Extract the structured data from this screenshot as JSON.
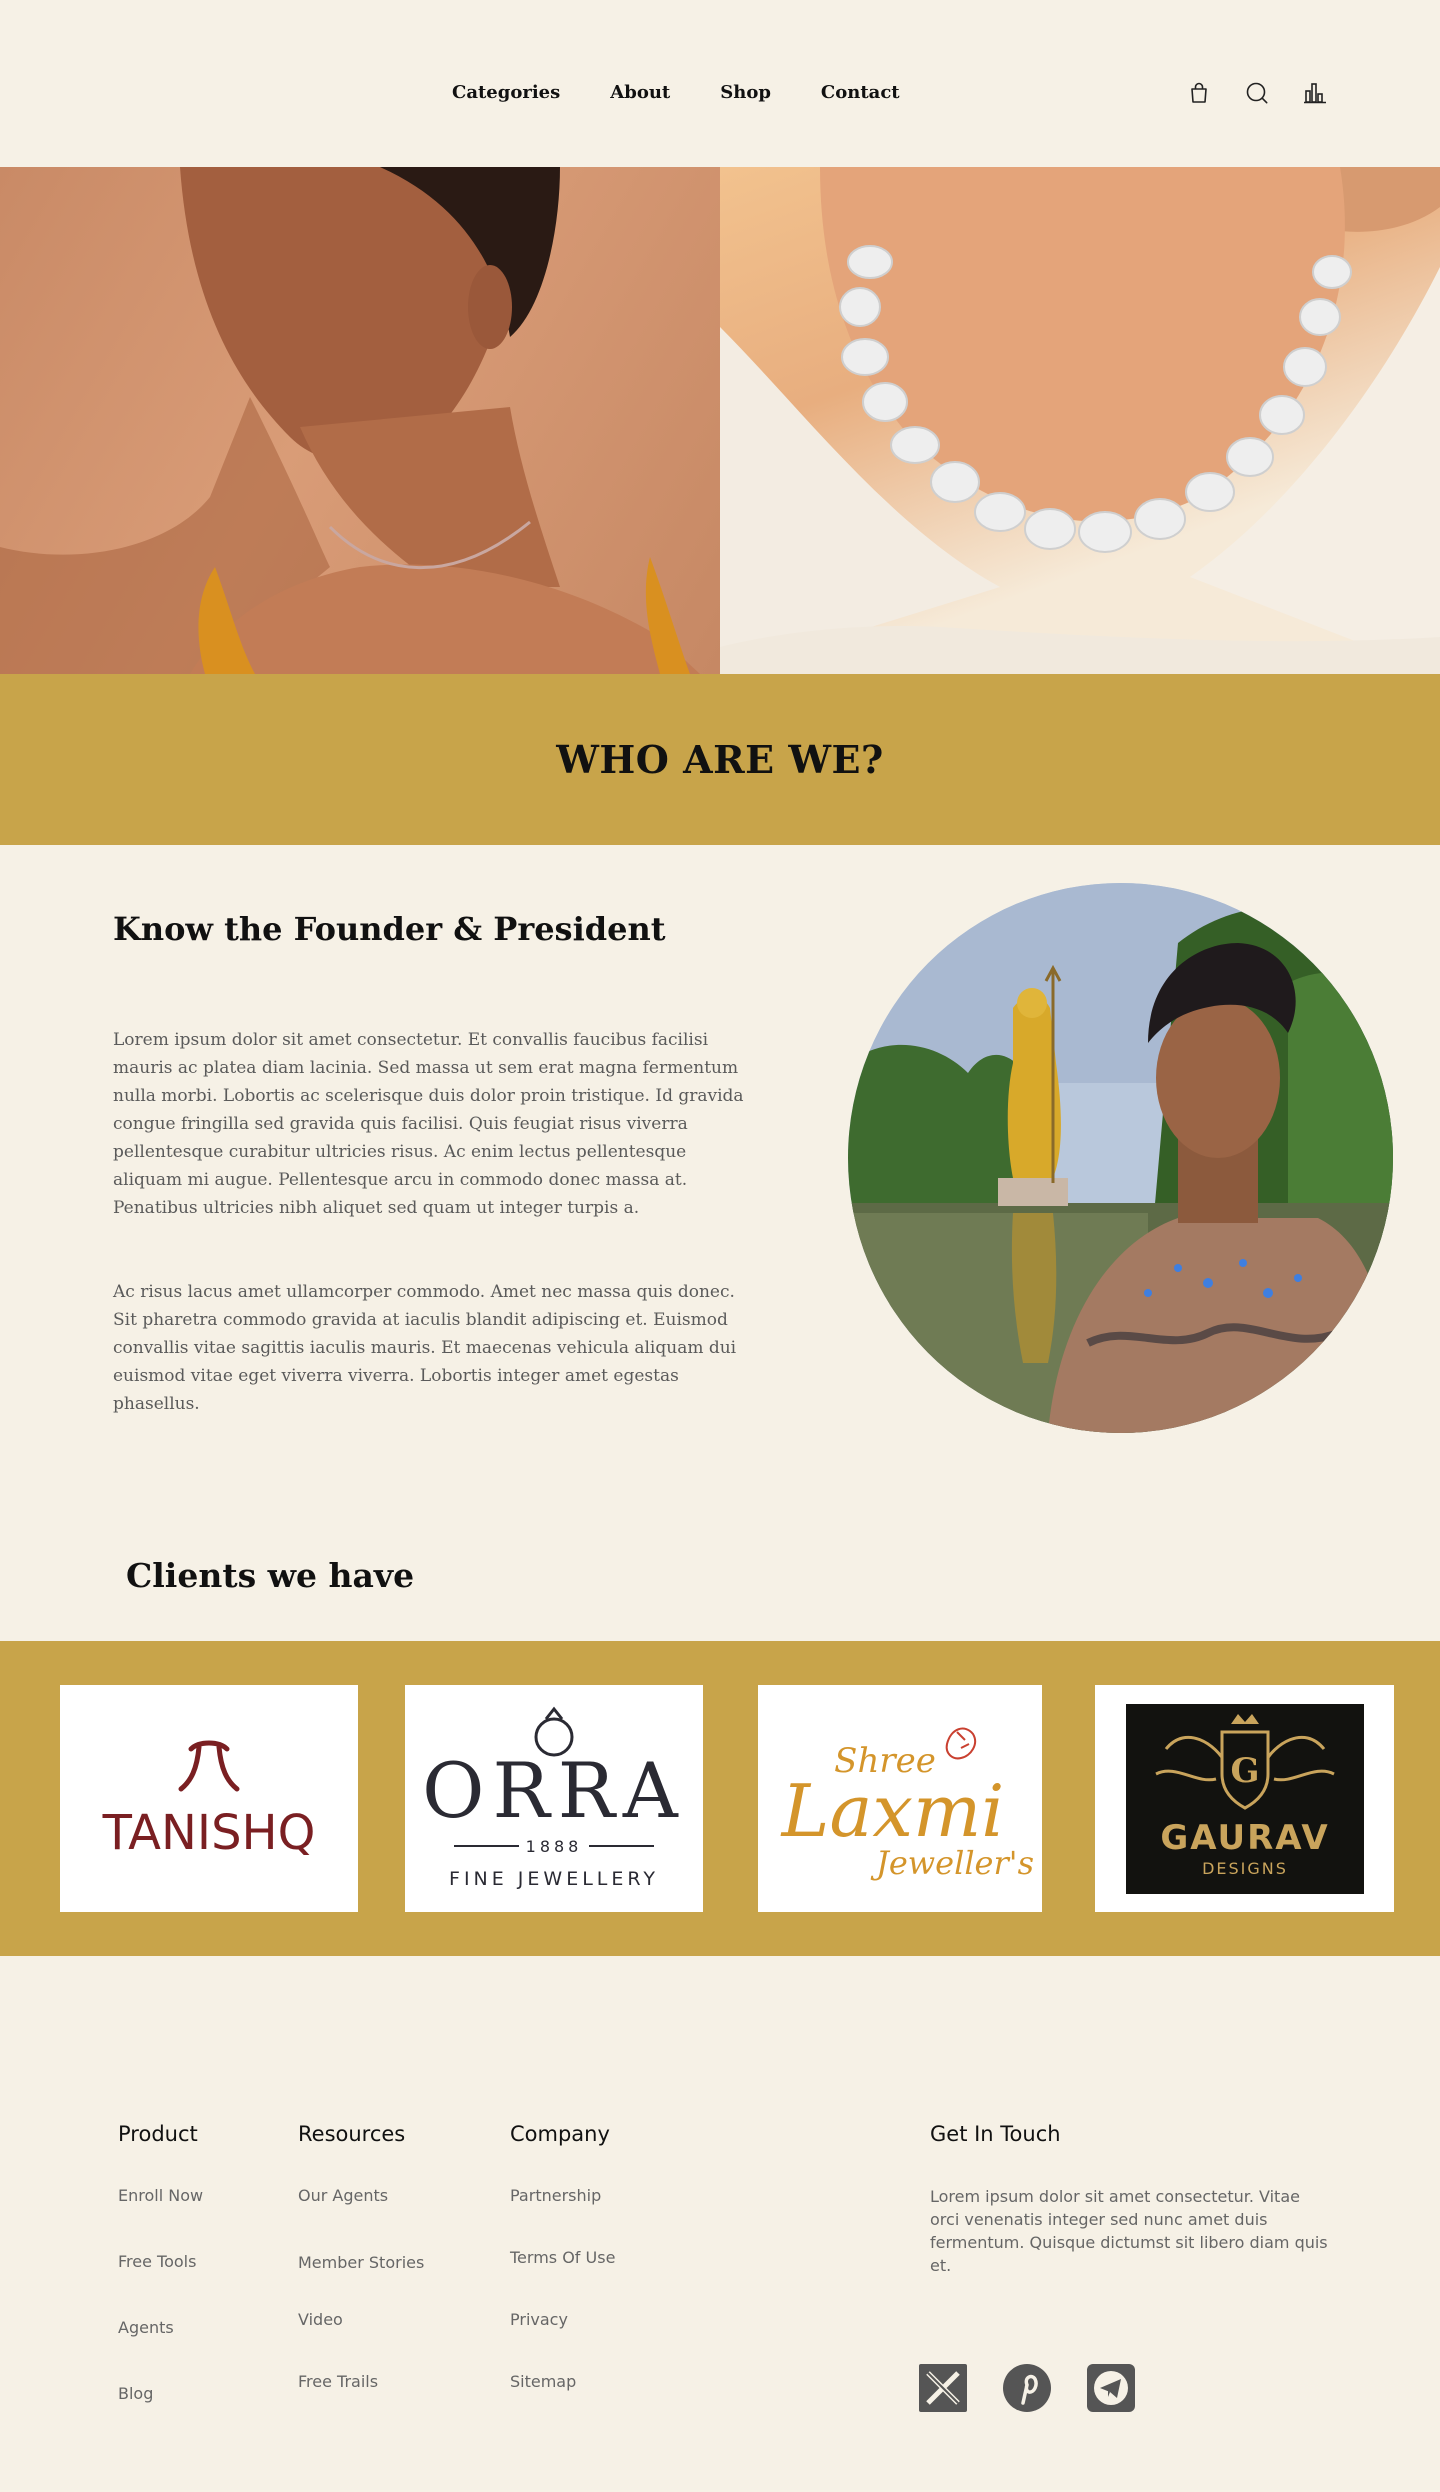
{
  "nav": {
    "links": [
      {
        "label": "Categories"
      },
      {
        "label": "About"
      },
      {
        "label": "Shop"
      },
      {
        "label": "Contact"
      }
    ],
    "icons": [
      "shopping-bag-icon",
      "search-icon",
      "bar-chart-icon"
    ]
  },
  "hero": {
    "left_image": "woman-wearing-fine-chain-necklace",
    "right_image": "woman-wearing-baroque-pearl-necklace"
  },
  "who": {
    "heading": "WHO ARE WE?"
  },
  "founder": {
    "title": "Know the Founder & President",
    "paragraph1": "Lorem ipsum dolor sit amet consectetur. Et convallis faucibus facilisi mauris ac platea diam lacinia. Sed massa ut sem erat magna fermentum nulla morbi. Lobortis ac scelerisque duis dolor proin tristique. Id gravida congue fringilla sed gravida quis facilisi. Quis feugiat risus viverra pellentesque curabitur ultricies risus. Ac enim lectus pellentesque aliquam mi augue. Pellentesque arcu in commodo donec massa at. Penatibus ultricies nibh aliquet sed quam ut integer turpis a.",
    "paragraph2": "Ac risus lacus amet ullamcorper commodo. Amet nec massa quis donec. Sit pharetra commodo gravida at iaculis blandit adipiscing et. Euismod convallis vitae sagittis iaculis mauris. Et maecenas vehicula aliquam dui euismod vitae eget viverra viverra. Lobortis integer amet egestas phasellus.",
    "photo": "founder-portrait"
  },
  "clients": {
    "title": "Clients we have",
    "logos": [
      {
        "name": "Tanishq",
        "text": "TANISHQ"
      },
      {
        "name": "Orra",
        "text": "ORRA",
        "sub_year": "1888",
        "sub": "FINE JEWELLERY"
      },
      {
        "name": "Shree Laxmi Jeweller's",
        "text_top": "Shree",
        "text_main": "Laxmi",
        "text_bottom": "Jeweller's"
      },
      {
        "name": "Gaurav Designs",
        "text": "GAURAV",
        "sub": "DESIGNS",
        "monogram": "G"
      }
    ]
  },
  "footer": {
    "product": {
      "heading": "Product",
      "links": [
        "Enroll Now",
        "Free Tools",
        "Agents",
        "Blog"
      ]
    },
    "resources": {
      "heading": "Resources",
      "links": [
        "Our Agents",
        "Member Stories",
        "Video",
        "Free Trails"
      ]
    },
    "company": {
      "heading": "Company",
      "links": [
        "Partnership",
        "Terms Of Use",
        "Privacy",
        "Sitemap"
      ]
    },
    "touch": {
      "heading": "Get In Touch",
      "text": "Lorem ipsum dolor sit amet consectetur. Vitae orci venenatis integer sed nunc amet duis fermentum. Quisque dictumst sit libero diam quis et."
    },
    "social": [
      "x-twitter-icon",
      "pinterest-icon",
      "telegram-icon"
    ]
  },
  "colors": {
    "background": "#f6f1e6",
    "accent_gold": "#c8a44a",
    "text_dark": "#111111",
    "text_muted": "#5a5a5a"
  }
}
